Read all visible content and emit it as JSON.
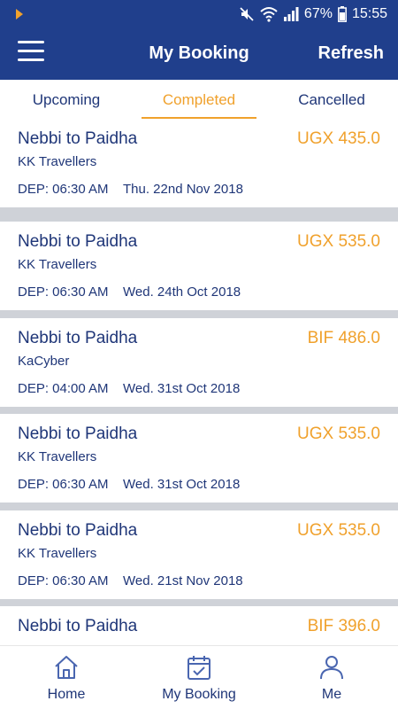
{
  "status_bar": {
    "battery": "67%",
    "time": "15:55",
    "icons": [
      "notification-icon",
      "mute-icon",
      "wifi-icon",
      "signal-icon",
      "battery-icon"
    ]
  },
  "header": {
    "menu_icon": "hamburger-menu-icon",
    "title": "My Booking",
    "refresh_label": "Refresh"
  },
  "tabs": [
    {
      "label": "Upcoming",
      "active": false
    },
    {
      "label": "Completed",
      "active": true
    },
    {
      "label": "Cancelled",
      "active": false
    }
  ],
  "bookings": [
    {
      "route": "Nebbi to Paidha",
      "operator": "KK Travellers",
      "price": "UGX 435.0",
      "dep": "DEP: 06:30 AM",
      "date": "Thu. 22nd Nov 2018"
    },
    {
      "route": "Nebbi to Paidha",
      "operator": "KK Travellers",
      "price": "UGX 535.0",
      "dep": "DEP: 06:30 AM",
      "date": "Wed. 24th Oct 2018"
    },
    {
      "route": "Nebbi to Paidha",
      "operator": "KaCyber",
      "price": "BIF 486.0",
      "dep": "DEP: 04:00 AM",
      "date": "Wed. 31st Oct 2018"
    },
    {
      "route": "Nebbi to Paidha",
      "operator": "KK Travellers",
      "price": "UGX 535.0",
      "dep": "DEP: 06:30 AM",
      "date": "Wed. 31st Oct 2018"
    },
    {
      "route": "Nebbi to Paidha",
      "operator": "KK Travellers",
      "price": "UGX 535.0",
      "dep": "DEP: 06:30 AM",
      "date": "Wed. 21st Nov 2018"
    },
    {
      "route": "Nebbi to Paidha",
      "operator": "",
      "price": "BIF 396.0",
      "dep": "",
      "date": ""
    }
  ],
  "bottom_nav": [
    {
      "label": "Home",
      "icon": "home-icon"
    },
    {
      "label": "My Booking",
      "icon": "calendar-check-icon"
    },
    {
      "label": "Me",
      "icon": "user-icon"
    }
  ],
  "colors": {
    "primary": "#203f8c",
    "text": "#1f3678",
    "accent": "#f0a12c",
    "separator": "#cfd2d8"
  }
}
